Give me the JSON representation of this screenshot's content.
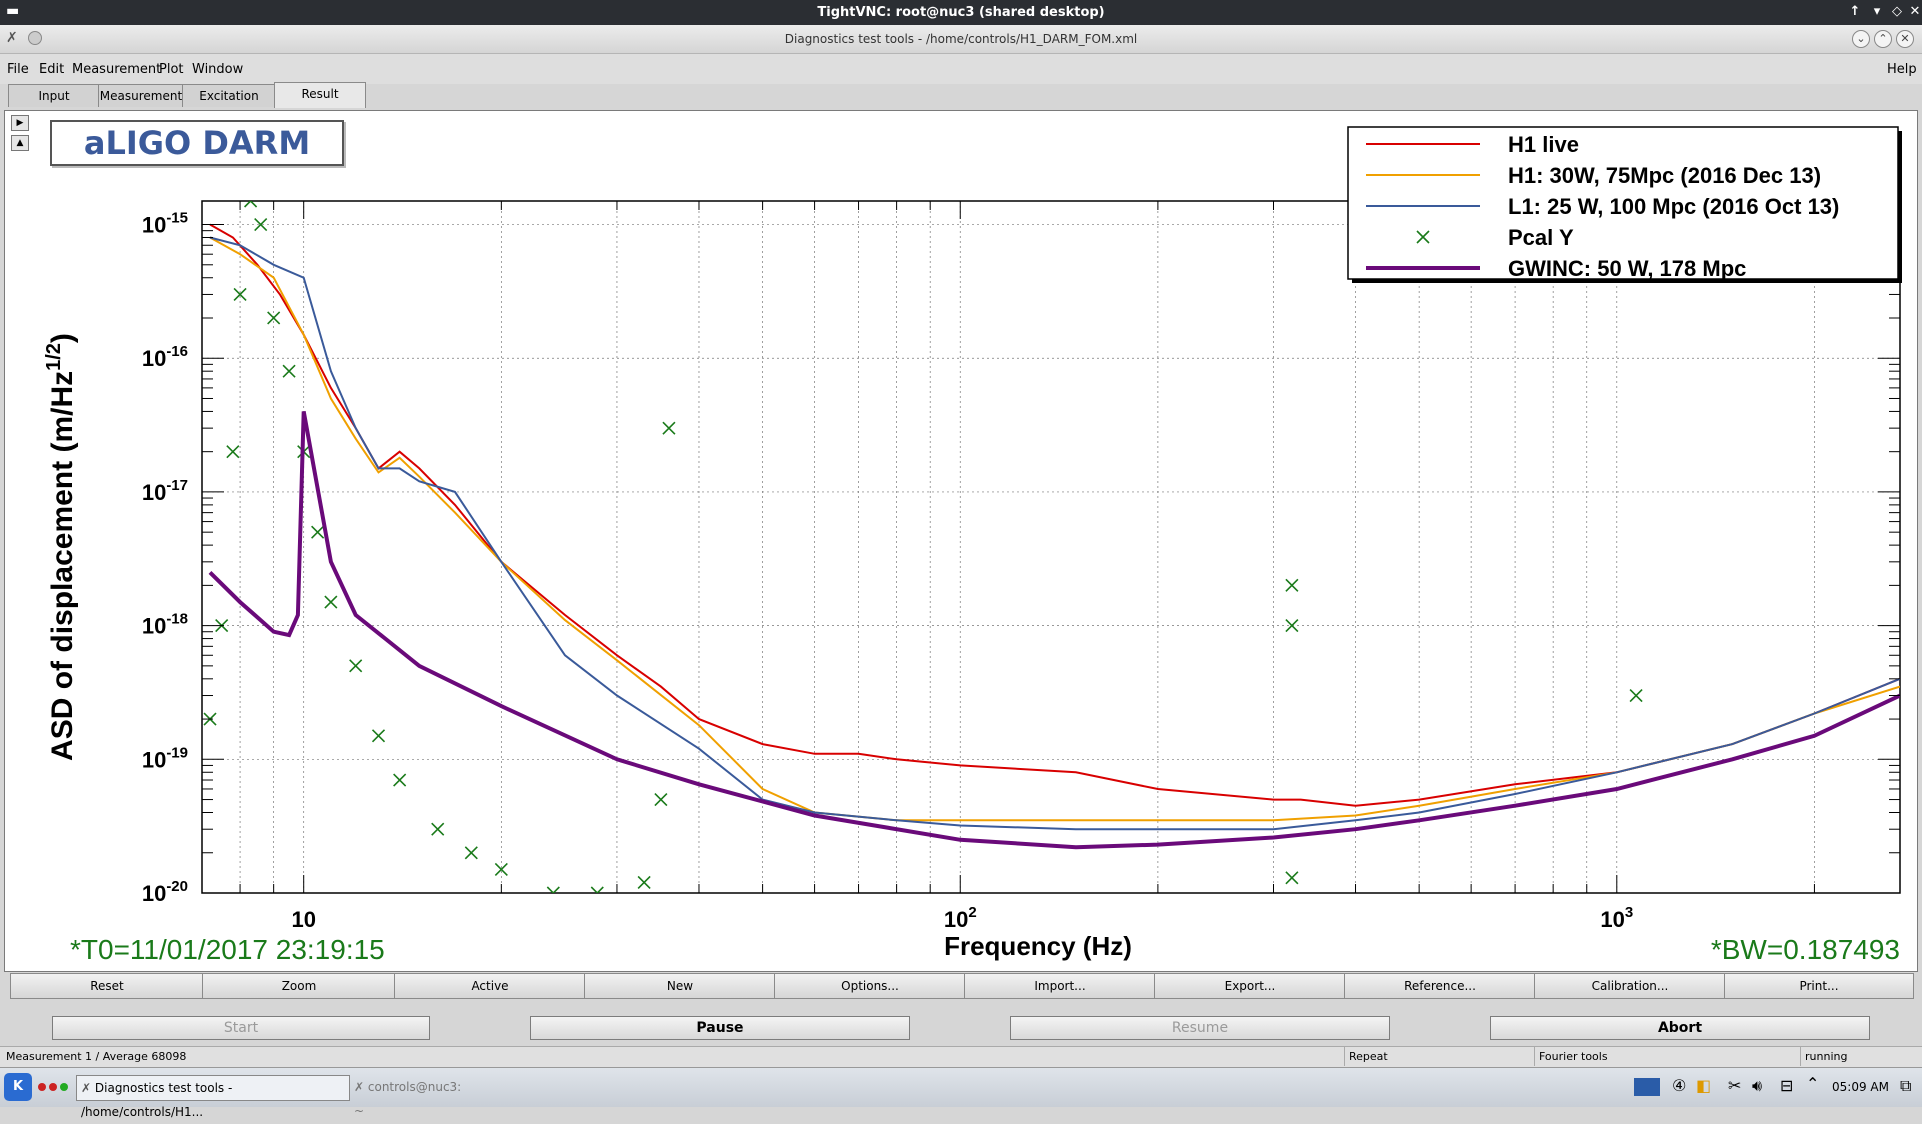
{
  "vnc": {
    "title": "TightVNC: root@nuc3 (shared desktop)"
  },
  "app": {
    "title": "Diagnostics test tools - /home/controls/H1_DARM_FOM.xml",
    "menu": [
      "File",
      "Edit",
      "Measurement",
      "Plot",
      "Window"
    ],
    "help": "Help",
    "tabs": [
      "Input",
      "Measurement",
      "Excitation",
      "Result"
    ],
    "active_tab": "Result"
  },
  "plot": {
    "box_title": "aLIGO DARM",
    "t0": "*T0=11/01/2017 23:19:15",
    "bw": "*BW=0.187493"
  },
  "chart_data": {
    "type": "line",
    "xlabel": "Frequency (Hz)",
    "ylabel": "ASD of displacement (m/Hz^1/2)",
    "xscale": "log",
    "yscale": "log",
    "xlim": [
      7,
      2700
    ],
    "ylim": [
      1e-20,
      1.5e-15
    ],
    "x_tick_labels": [
      "10",
      "10^2",
      "10^3"
    ],
    "y_tick_labels": [
      "10^-15",
      "10^-16",
      "10^-17",
      "10^-18",
      "10^-19",
      "10^-20"
    ],
    "grid": true,
    "legend_position": "top-right",
    "series": [
      {
        "name": "H1 live",
        "color": "#d80000",
        "x": [
          7.2,
          7.8,
          8.5,
          9.2,
          10,
          11,
          12,
          13,
          14,
          15,
          17,
          20,
          25,
          30,
          35,
          40,
          50,
          60,
          70,
          80,
          100,
          150,
          200,
          300,
          330,
          400,
          500,
          700,
          1000,
          1500,
          2000,
          2700
        ],
        "y": [
          1e-15,
          8e-16,
          5e-16,
          3e-16,
          1.5e-16,
          6e-17,
          3e-17,
          1.5e-17,
          2e-17,
          1.5e-17,
          8e-18,
          3e-18,
          1.2e-18,
          6e-19,
          3.5e-19,
          2e-19,
          1.3e-19,
          1.1e-19,
          1.1e-19,
          1e-19,
          9e-20,
          8e-20,
          6e-20,
          5e-20,
          5e-20,
          4.5e-20,
          5e-20,
          6.5e-20,
          8e-20,
          1.3e-19,
          2.2e-19,
          4e-19
        ]
      },
      {
        "name": "H1: 30W, 75Mpc (2016 Dec 13)",
        "color": "#f0a000",
        "x": [
          7.2,
          8,
          9,
          10,
          11,
          12,
          13,
          14,
          15,
          17,
          20,
          25,
          30,
          40,
          50,
          60,
          80,
          100,
          150,
          200,
          300,
          400,
          500,
          700,
          1000,
          1500,
          2000,
          2700
        ],
        "y": [
          8e-16,
          6e-16,
          4e-16,
          1.5e-16,
          5e-17,
          2.5e-17,
          1.4e-17,
          1.8e-17,
          1.3e-17,
          7e-18,
          3e-18,
          1.1e-18,
          5.5e-19,
          1.8e-19,
          6e-20,
          4e-20,
          3.5e-20,
          3.5e-20,
          3.5e-20,
          3.5e-20,
          3.5e-20,
          3.8e-20,
          4.5e-20,
          6e-20,
          8e-20,
          1.3e-19,
          2.2e-19,
          3.5e-19
        ]
      },
      {
        "name": "L1: 25 W, 100 Mpc (2016 Oct 13)",
        "color": "#3a5a9a",
        "x": [
          7.2,
          8,
          9,
          10,
          11,
          12,
          13,
          14,
          15,
          17,
          20,
          25,
          30,
          40,
          50,
          60,
          80,
          100,
          150,
          200,
          300,
          400,
          500,
          700,
          1000,
          1500,
          2000,
          2700
        ],
        "y": [
          8e-16,
          7e-16,
          5e-16,
          4e-16,
          8e-17,
          3e-17,
          1.5e-17,
          1.5e-17,
          1.2e-17,
          1e-17,
          3e-18,
          6e-19,
          3e-19,
          1.2e-19,
          5e-20,
          4e-20,
          3.5e-20,
          3.2e-20,
          3e-20,
          3e-20,
          3e-20,
          3.5e-20,
          4e-20,
          5.5e-20,
          8e-20,
          1.3e-19,
          2.2e-19,
          4e-19
        ]
      },
      {
        "name": "Pcal Y",
        "color": "#1a7a1a",
        "marker": "x",
        "x": [
          7.2,
          7.5,
          7.8,
          8,
          8.3,
          8.6,
          9,
          9.5,
          10,
          10.5,
          11,
          12,
          13,
          14,
          16,
          18,
          20,
          24,
          28,
          33,
          35,
          36,
          320,
          320,
          320,
          1070
        ],
        "y": [
          2e-19,
          1e-18,
          2e-17,
          3e-16,
          1.5e-15,
          1e-15,
          2e-16,
          8e-17,
          2e-17,
          5e-18,
          1.5e-18,
          5e-19,
          1.5e-19,
          7e-20,
          3e-20,
          2e-20,
          1.5e-20,
          1e-20,
          1e-20,
          1.2e-20,
          5e-20,
          3e-17,
          1e-18,
          2e-18,
          1.3e-20,
          3e-19
        ]
      },
      {
        "name": "GWINC: 50 W, 178 Mpc",
        "color": "#6a0a7a",
        "x": [
          7.2,
          8,
          9,
          9.5,
          9.8,
          10,
          11,
          12,
          15,
          20,
          30,
          40,
          60,
          100,
          150,
          200,
          300,
          400,
          500,
          700,
          1000,
          1500,
          2000,
          2700
        ],
        "y": [
          2.5e-18,
          1.5e-18,
          9e-19,
          8.5e-19,
          1.2e-18,
          4e-17,
          3e-18,
          1.2e-18,
          5e-19,
          2.5e-19,
          1e-19,
          6.5e-20,
          3.8e-20,
          2.5e-20,
          2.2e-20,
          2.3e-20,
          2.6e-20,
          3e-20,
          3.5e-20,
          4.5e-20,
          6e-20,
          1e-19,
          1.5e-19,
          3e-19
        ]
      }
    ]
  },
  "toolbar": [
    "Reset",
    "Zoom",
    "Active",
    "New",
    "Options...",
    "Import...",
    "Export...",
    "Reference...",
    "Calibration...",
    "Print..."
  ],
  "controls": {
    "start": "Start",
    "pause": "Pause",
    "resume": "Resume",
    "abort": "Abort"
  },
  "status": {
    "measurement": "Measurement 1 / Average 68098",
    "repeat": "Repeat",
    "fourier": "Fourier tools",
    "state": "running"
  },
  "taskbar": {
    "task1": "Diagnostics test tools - /home/controls/H1...",
    "task2": "controls@nuc3: ~",
    "clock": "05:09 AM"
  }
}
